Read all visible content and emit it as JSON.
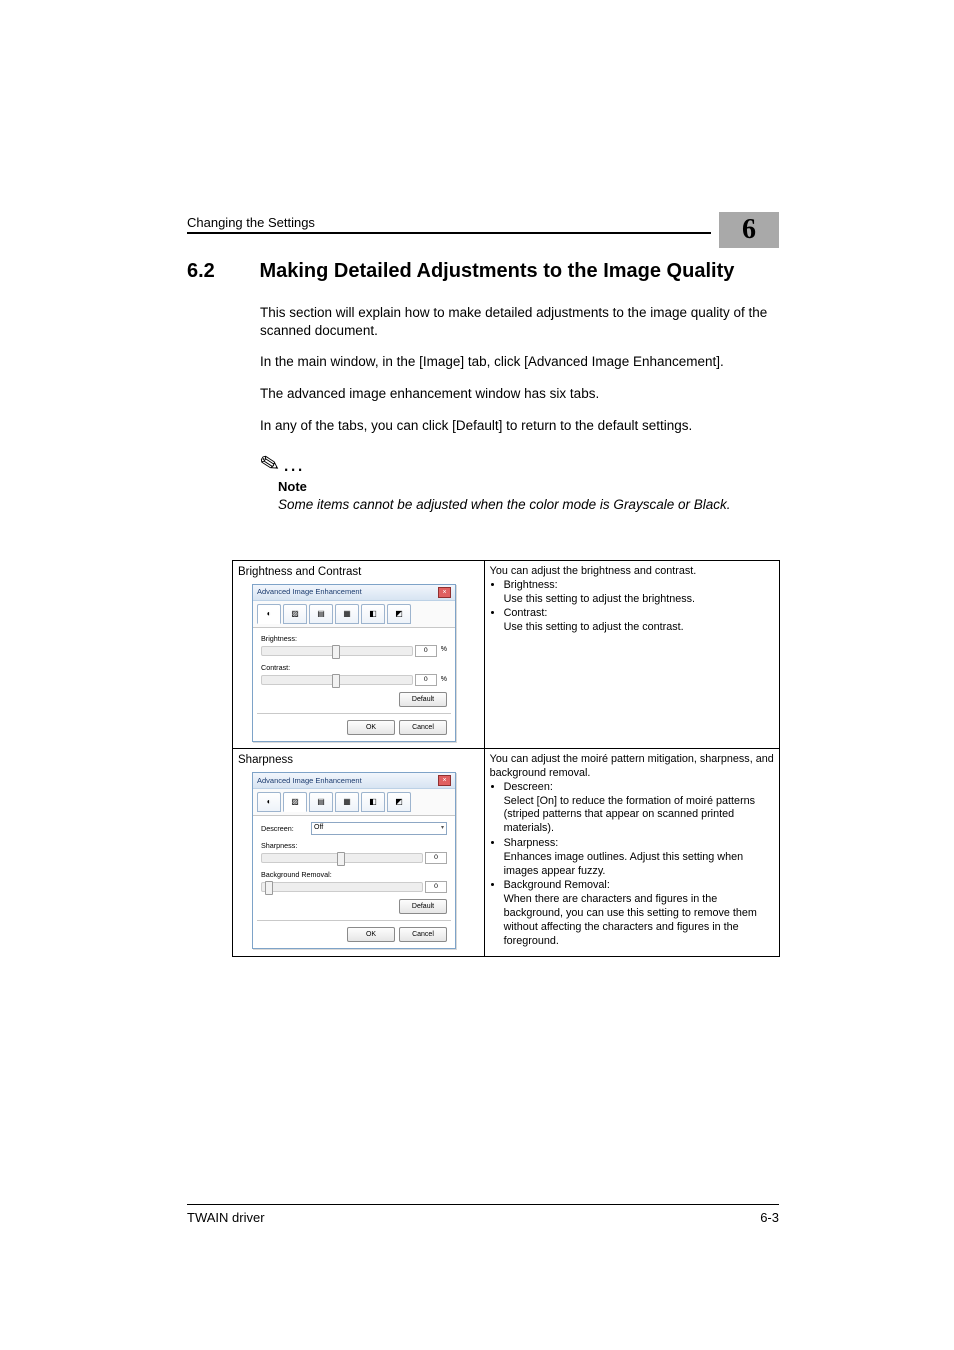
{
  "header": {
    "running_head": "Changing the Settings",
    "chapter_number": "6"
  },
  "section": {
    "number": "6.2",
    "title": "Making Detailed Adjustments to the Image Quality"
  },
  "paras": {
    "p1": "This section will explain how to make detailed adjustments to the image quality of the scanned document.",
    "p2": "In the main window, in the [Image] tab, click [Advanced Image Enhancement].",
    "p3": "The advanced image enhancement window has six tabs.",
    "p4": "In any of the tabs, you can click [Default] to return to the default settings."
  },
  "note": {
    "label": "Note",
    "text": "Some items cannot be adjusted when the color mode is Grayscale or Black."
  },
  "table": {
    "row1": {
      "name": "Brightness and Contrast",
      "desc_intro": "You can adjust the brightness and contrast.",
      "items": [
        {
          "label": "Brightness:",
          "desc": "Use this setting to adjust the brightness."
        },
        {
          "label": "Contrast:",
          "desc": "Use this setting to adjust the contrast."
        }
      ]
    },
    "row2": {
      "name": "Sharpness",
      "desc_intro": "You can adjust the moiré pattern mitigation, sharpness, and background removal.",
      "items": [
        {
          "label": "Descreen:",
          "desc": "Select [On] to reduce the formation of moiré patterns (striped patterns that appear on scanned printed materials)."
        },
        {
          "label": "Sharpness:",
          "desc": "Enhances image outlines. Adjust this setting when images appear fuzzy."
        },
        {
          "label": "Background Removal:",
          "desc": "When there are characters and figures in the background, you can use this setting to remove them without affecting the characters and figures in the foreground."
        }
      ]
    }
  },
  "dialog": {
    "title": "Advanced Image Enhancement",
    "labels": {
      "brightness": "Brightness:",
      "contrast": "Contrast:",
      "descreen": "Descreen:",
      "descreen_value": "Off",
      "sharpness": "Sharpness:",
      "bg_removal": "Background Removal:"
    },
    "values": {
      "brightness": "0",
      "contrast": "0",
      "sharpness": "0",
      "bg_removal": "0",
      "pct": "%"
    },
    "buttons": {
      "default": "Default",
      "ok": "OK",
      "cancel": "Cancel"
    }
  },
  "footer": {
    "left": "TWAIN driver",
    "right": "6-3"
  }
}
